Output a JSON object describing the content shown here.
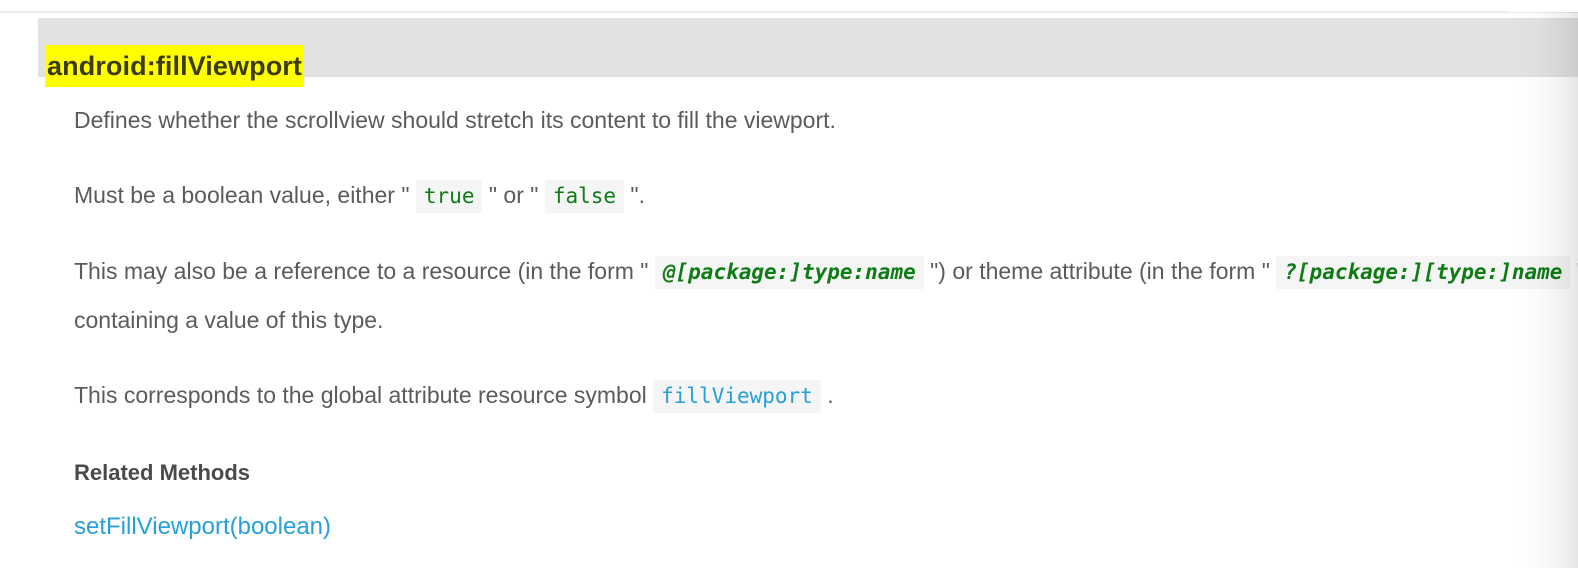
{
  "attribute": {
    "name": "android:fillViewport",
    "highlight_color": "#ffff00",
    "header_background": "#e2e2e2"
  },
  "paragraphs": {
    "description": "Defines whether the scrollview should stretch its content to fill the viewport.",
    "boolean_lead": "Must be a boolean value, either \" ",
    "boolean_true": "true",
    "boolean_mid": " \" or \" ",
    "boolean_false": "false",
    "boolean_tail": " \".",
    "reference_lead": "This may also be a reference to a resource (in the form \" ",
    "reference_code": "@[package:]type:name",
    "reference_mid": " \") or theme attribute (in the form \" ",
    "theme_code": "?[package:][type:]name",
    "reference_tail": " \") containing a value of this type.",
    "symbol_lead": "This corresponds to the global attribute resource symbol ",
    "symbol_code": "fillViewport",
    "symbol_tail": " ."
  },
  "related": {
    "heading": "Related Methods",
    "methods": [
      {
        "label": "setFillViewport(boolean)"
      }
    ]
  },
  "colors": {
    "body_text": "#5b5b5b",
    "code_text": "#0f7b15",
    "link": "#26a0da",
    "code_background": "#f4f5f4"
  }
}
